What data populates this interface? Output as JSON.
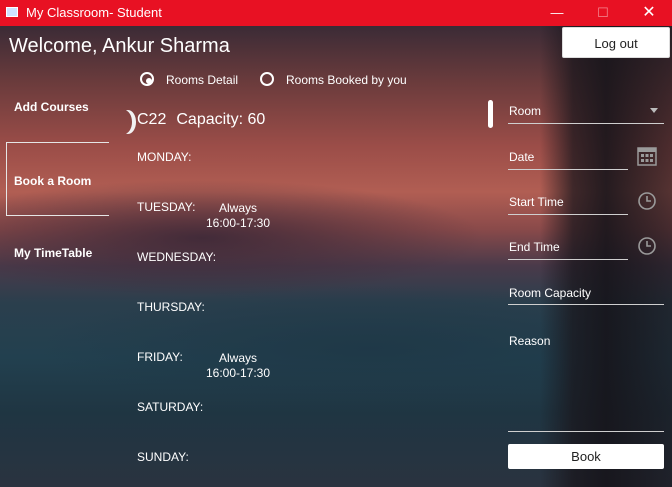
{
  "window": {
    "title": "My Classroom- Student"
  },
  "header": {
    "welcome": "Welcome, Ankur Sharma",
    "logout_label": "Log out"
  },
  "sidebar": {
    "items": [
      {
        "label": "Add Courses"
      },
      {
        "label": "Book a Room",
        "active": true
      },
      {
        "label": "My TimeTable"
      }
    ]
  },
  "view_options": [
    {
      "label": "Rooms Detail",
      "selected": true
    },
    {
      "label": "Rooms Booked by you",
      "selected": false
    }
  ],
  "room": {
    "name": "C22",
    "capacity_text": "Capacity: 60"
  },
  "schedule": [
    {
      "day": "MONDAY:",
      "slot_label": "",
      "slot_time": ""
    },
    {
      "day": "TUESDAY:",
      "slot_label": "Always",
      "slot_time": "16:00-17:30"
    },
    {
      "day": "WEDNESDAY:",
      "slot_label": "",
      "slot_time": ""
    },
    {
      "day": "THURSDAY:",
      "slot_label": "",
      "slot_time": ""
    },
    {
      "day": "FRIDAY:",
      "slot_label": "Always",
      "slot_time": "16:00-17:30"
    },
    {
      "day": "SATURDAY:",
      "slot_label": "",
      "slot_time": ""
    },
    {
      "day": "SUNDAY:",
      "slot_label": "",
      "slot_time": ""
    }
  ],
  "form": {
    "room_placeholder": "Room",
    "date_placeholder": "Date",
    "start_time_placeholder": "Start Time",
    "end_time_placeholder": "End Time",
    "capacity_placeholder": "Room Capacity",
    "reason_placeholder": "Reason",
    "book_label": "Book"
  },
  "colors": {
    "titlebar": "#e81123",
    "text": "#ffffff"
  },
  "icons": [
    "app-icon",
    "minimize-icon",
    "maximize-icon",
    "close-icon",
    "calendar-icon",
    "clock-icon",
    "dropdown-arrow-icon"
  ]
}
